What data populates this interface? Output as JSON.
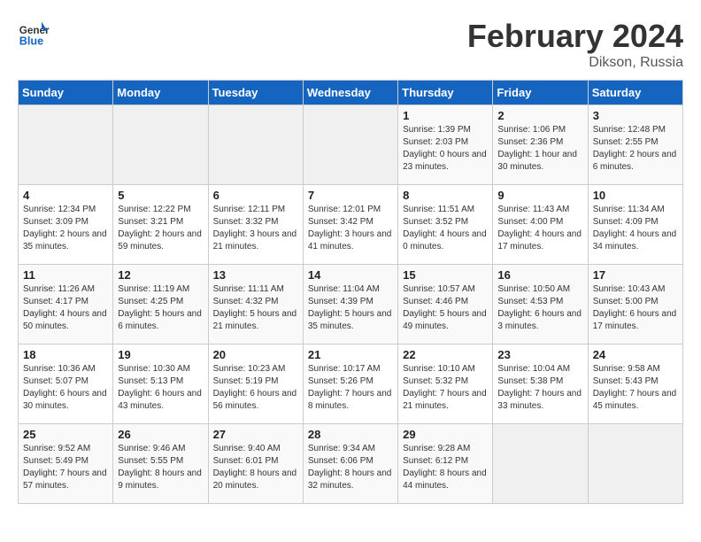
{
  "header": {
    "logo_line1": "General",
    "logo_line2": "Blue",
    "month": "February 2024",
    "location": "Dikson, Russia"
  },
  "days_of_week": [
    "Sunday",
    "Monday",
    "Tuesday",
    "Wednesday",
    "Thursday",
    "Friday",
    "Saturday"
  ],
  "weeks": [
    [
      {
        "day": "",
        "info": ""
      },
      {
        "day": "",
        "info": ""
      },
      {
        "day": "",
        "info": ""
      },
      {
        "day": "",
        "info": ""
      },
      {
        "day": "1",
        "info": "Sunrise: 1:39 PM\nSunset: 2:03 PM\nDaylight: 0 hours and 23 minutes."
      },
      {
        "day": "2",
        "info": "Sunrise: 1:06 PM\nSunset: 2:36 PM\nDaylight: 1 hour and 30 minutes."
      },
      {
        "day": "3",
        "info": "Sunrise: 12:48 PM\nSunset: 2:55 PM\nDaylight: 2 hours and 6 minutes."
      }
    ],
    [
      {
        "day": "4",
        "info": "Sunrise: 12:34 PM\nSunset: 3:09 PM\nDaylight: 2 hours and 35 minutes."
      },
      {
        "day": "5",
        "info": "Sunrise: 12:22 PM\nSunset: 3:21 PM\nDaylight: 2 hours and 59 minutes."
      },
      {
        "day": "6",
        "info": "Sunrise: 12:11 PM\nSunset: 3:32 PM\nDaylight: 3 hours and 21 minutes."
      },
      {
        "day": "7",
        "info": "Sunrise: 12:01 PM\nSunset: 3:42 PM\nDaylight: 3 hours and 41 minutes."
      },
      {
        "day": "8",
        "info": "Sunrise: 11:51 AM\nSunset: 3:52 PM\nDaylight: 4 hours and 0 minutes."
      },
      {
        "day": "9",
        "info": "Sunrise: 11:43 AM\nSunset: 4:00 PM\nDaylight: 4 hours and 17 minutes."
      },
      {
        "day": "10",
        "info": "Sunrise: 11:34 AM\nSunset: 4:09 PM\nDaylight: 4 hours and 34 minutes."
      }
    ],
    [
      {
        "day": "11",
        "info": "Sunrise: 11:26 AM\nSunset: 4:17 PM\nDaylight: 4 hours and 50 minutes."
      },
      {
        "day": "12",
        "info": "Sunrise: 11:19 AM\nSunset: 4:25 PM\nDaylight: 5 hours and 6 minutes."
      },
      {
        "day": "13",
        "info": "Sunrise: 11:11 AM\nSunset: 4:32 PM\nDaylight: 5 hours and 21 minutes."
      },
      {
        "day": "14",
        "info": "Sunrise: 11:04 AM\nSunset: 4:39 PM\nDaylight: 5 hours and 35 minutes."
      },
      {
        "day": "15",
        "info": "Sunrise: 10:57 AM\nSunset: 4:46 PM\nDaylight: 5 hours and 49 minutes."
      },
      {
        "day": "16",
        "info": "Sunrise: 10:50 AM\nSunset: 4:53 PM\nDaylight: 6 hours and 3 minutes."
      },
      {
        "day": "17",
        "info": "Sunrise: 10:43 AM\nSunset: 5:00 PM\nDaylight: 6 hours and 17 minutes."
      }
    ],
    [
      {
        "day": "18",
        "info": "Sunrise: 10:36 AM\nSunset: 5:07 PM\nDaylight: 6 hours and 30 minutes."
      },
      {
        "day": "19",
        "info": "Sunrise: 10:30 AM\nSunset: 5:13 PM\nDaylight: 6 hours and 43 minutes."
      },
      {
        "day": "20",
        "info": "Sunrise: 10:23 AM\nSunset: 5:19 PM\nDaylight: 6 hours and 56 minutes."
      },
      {
        "day": "21",
        "info": "Sunrise: 10:17 AM\nSunset: 5:26 PM\nDaylight: 7 hours and 8 minutes."
      },
      {
        "day": "22",
        "info": "Sunrise: 10:10 AM\nSunset: 5:32 PM\nDaylight: 7 hours and 21 minutes."
      },
      {
        "day": "23",
        "info": "Sunrise: 10:04 AM\nSunset: 5:38 PM\nDaylight: 7 hours and 33 minutes."
      },
      {
        "day": "24",
        "info": "Sunrise: 9:58 AM\nSunset: 5:43 PM\nDaylight: 7 hours and 45 minutes."
      }
    ],
    [
      {
        "day": "25",
        "info": "Sunrise: 9:52 AM\nSunset: 5:49 PM\nDaylight: 7 hours and 57 minutes."
      },
      {
        "day": "26",
        "info": "Sunrise: 9:46 AM\nSunset: 5:55 PM\nDaylight: 8 hours and 9 minutes."
      },
      {
        "day": "27",
        "info": "Sunrise: 9:40 AM\nSunset: 6:01 PM\nDaylight: 8 hours and 20 minutes."
      },
      {
        "day": "28",
        "info": "Sunrise: 9:34 AM\nSunset: 6:06 PM\nDaylight: 8 hours and 32 minutes."
      },
      {
        "day": "29",
        "info": "Sunrise: 9:28 AM\nSunset: 6:12 PM\nDaylight: 8 hours and 44 minutes."
      },
      {
        "day": "",
        "info": ""
      },
      {
        "day": "",
        "info": ""
      }
    ]
  ]
}
